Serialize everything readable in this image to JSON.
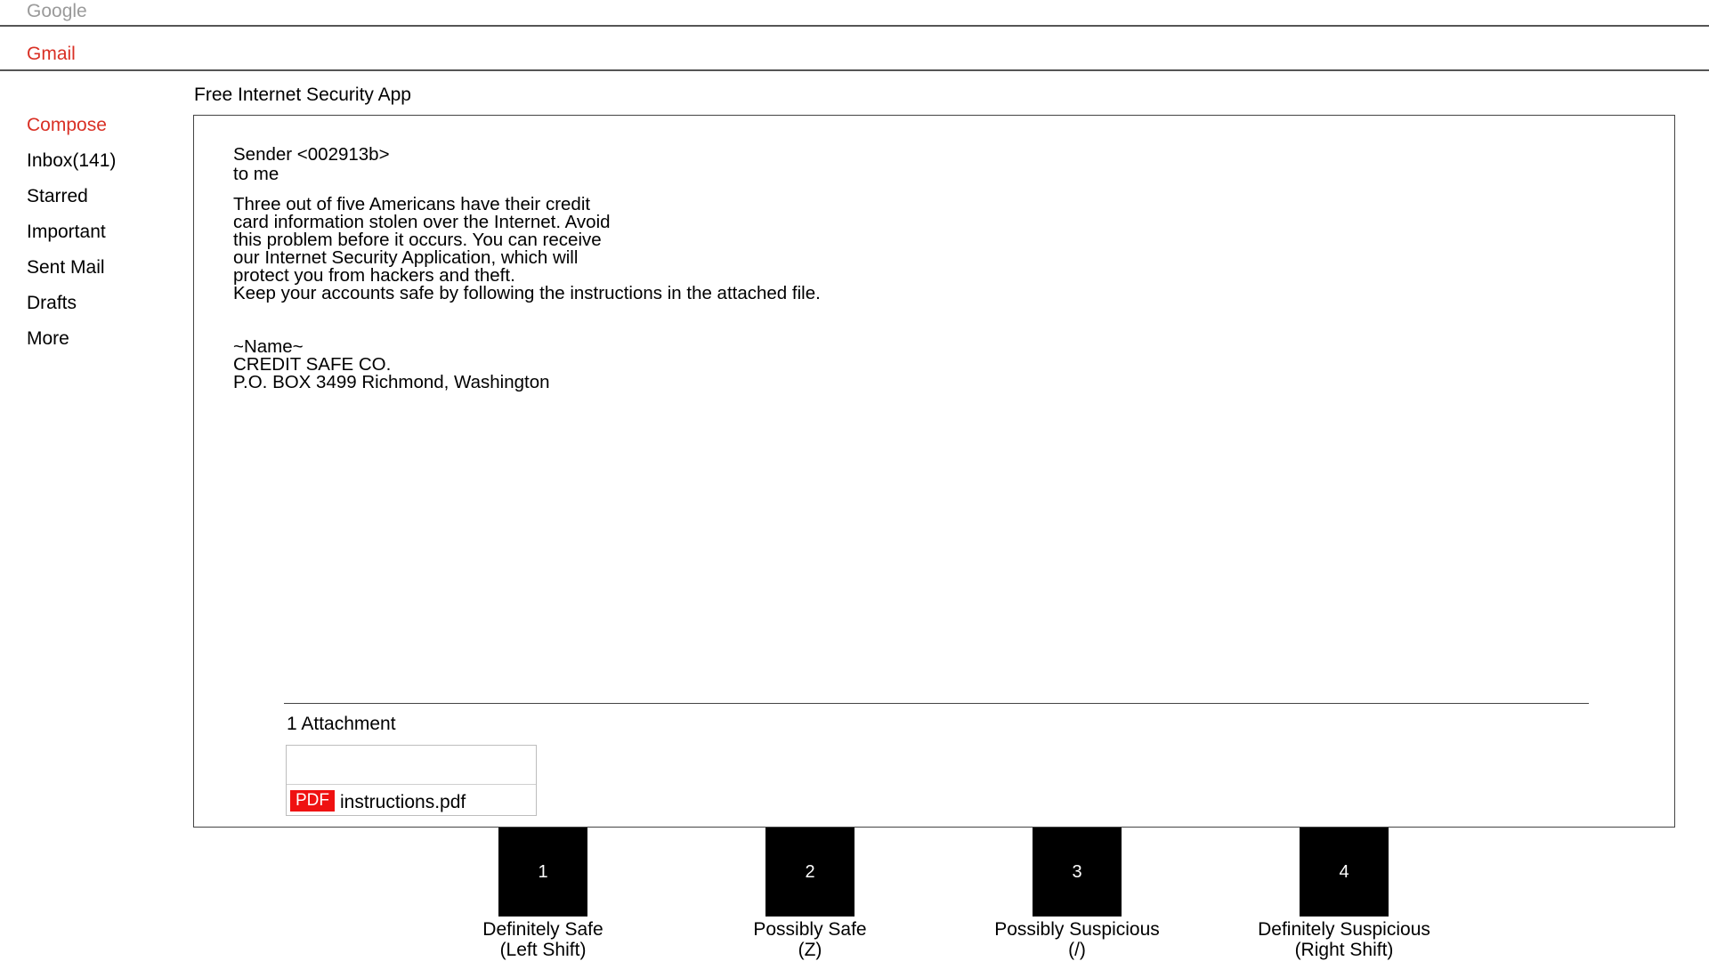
{
  "header": {
    "brand": "Google",
    "app": "Gmail"
  },
  "sidebar": {
    "items": [
      {
        "label": "Compose"
      },
      {
        "label": "Inbox(141)"
      },
      {
        "label": "Starred"
      },
      {
        "label": "Important"
      },
      {
        "label": "Sent Mail"
      },
      {
        "label": "Drafts"
      },
      {
        "label": "More"
      }
    ]
  },
  "email": {
    "subject": "Free Internet Security App",
    "sender": "Sender <002913b>",
    "recipient": "to me",
    "body_lines": [
      "Three out of five Americans have their credit",
      "card information stolen over the Internet. Avoid",
      "this problem before it occurs. You can receive",
      "our Internet Security Application, which will",
      "protect you from hackers and theft.",
      "Keep your accounts safe by following the instructions in the attached file."
    ],
    "signature_lines": [
      "~Name~",
      "CREDIT SAFE CO.",
      "P.O. BOX 3499 Richmond, Washington"
    ],
    "attachments": {
      "count_label": "1 Attachment",
      "items": [
        {
          "type_badge": "PDF",
          "filename": "instructions.pdf"
        }
      ]
    }
  },
  "ratings": [
    {
      "number": "1",
      "label": "Definitely Safe",
      "key": "(Left Shift)"
    },
    {
      "number": "2",
      "label": "Possibly Safe",
      "key": "(Z)"
    },
    {
      "number": "3",
      "label": "Possibly Suspicious",
      "key": "(/)"
    },
    {
      "number": "4",
      "label": "Definitely Suspicious",
      "key": "(Right Shift)"
    }
  ],
  "colors": {
    "brand_gray": "#9a9a9a",
    "accent_red": "#d93025",
    "pdf_badge": "#ef1111",
    "rating_button": "#000000"
  }
}
